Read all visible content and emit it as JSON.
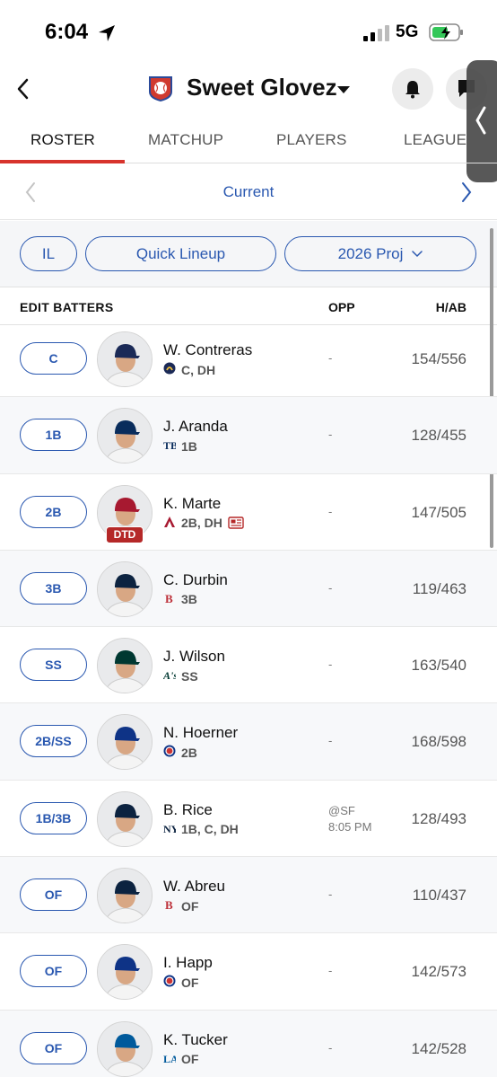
{
  "status": {
    "time": "6:04",
    "network": "5G"
  },
  "header": {
    "team_name": "Sweet Glovez"
  },
  "tabs": [
    {
      "label": "ROSTER",
      "active": true
    },
    {
      "label": "MATCHUP",
      "active": false
    },
    {
      "label": "PLAYERS",
      "active": false
    },
    {
      "label": "LEAGUE",
      "active": false
    }
  ],
  "period": {
    "label": "Current"
  },
  "filters": {
    "il": "IL",
    "quick_lineup": "Quick Lineup",
    "projection": "2026 Proj"
  },
  "table": {
    "title": "EDIT BATTERS",
    "opp_header": "OPP",
    "stat_header": "H/AB"
  },
  "colors": {
    "accent_blue": "#2a58b0",
    "tab_red": "#d7332c",
    "dtd_red": "#b52828"
  },
  "players": [
    {
      "slot": "C",
      "name": "W. Contreras",
      "team_icon": "brewers-logo",
      "positions": "C, DH",
      "opp": "-",
      "stat": "154/556"
    },
    {
      "slot": "1B",
      "name": "J. Aranda",
      "team_icon": "rays-logo",
      "positions": "1B",
      "opp": "-",
      "stat": "128/455"
    },
    {
      "slot": "2B",
      "name": "K. Marte",
      "team_icon": "diamondbacks-logo",
      "positions": "2B, DH",
      "opp": "-",
      "stat": "147/505",
      "badge": "DTD",
      "news_icon": "news-icon"
    },
    {
      "slot": "3B",
      "name": "C. Durbin",
      "team_icon": "red-sox-logo",
      "positions": "3B",
      "opp": "-",
      "stat": "119/463"
    },
    {
      "slot": "SS",
      "name": "J. Wilson",
      "team_icon": "athletics-logo",
      "positions": "SS",
      "opp": "-",
      "stat": "163/540"
    },
    {
      "slot": "2B/SS",
      "name": "N. Hoerner",
      "team_icon": "cubs-logo",
      "positions": "2B",
      "opp": "-",
      "stat": "168/598"
    },
    {
      "slot": "1B/3B",
      "name": "B. Rice",
      "team_icon": "yankees-logo",
      "positions": "1B, C, DH",
      "opp_line1": "@SF",
      "opp_line2": "8:05 PM",
      "stat": "128/493"
    },
    {
      "slot": "OF",
      "name": "W. Abreu",
      "team_icon": "red-sox-logo",
      "positions": "OF",
      "opp": "-",
      "stat": "110/437"
    },
    {
      "slot": "OF",
      "name": "I. Happ",
      "team_icon": "cubs-logo",
      "positions": "OF",
      "opp": "-",
      "stat": "142/573"
    },
    {
      "slot": "OF",
      "name": "K. Tucker",
      "team_icon": "dodgers-logo",
      "positions": "OF",
      "opp": "-",
      "stat": "142/528"
    }
  ]
}
